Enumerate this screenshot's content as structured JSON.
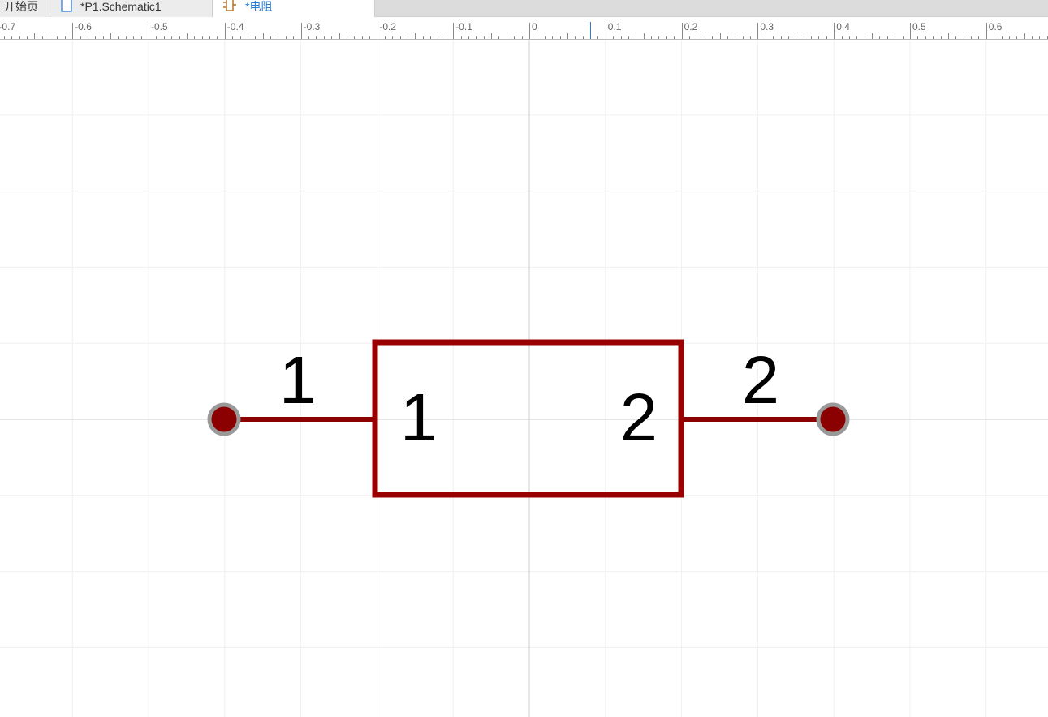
{
  "tabs": [
    {
      "label": "开始页",
      "icon": "none",
      "active": false
    },
    {
      "label": "*P1.Schematic1",
      "icon": "schematic-file-icon",
      "active": false
    },
    {
      "label": "*电阻",
      "icon": "symbol-icon",
      "active": true
    }
  ],
  "ruler": {
    "labels": [
      "-0.7",
      "-0.6",
      "-0.5",
      "-0.4",
      "-0.3",
      "-0.2",
      "-0.1",
      "0",
      "0.1",
      "0.2",
      "0.3",
      "0.4",
      "0.5",
      "0.6"
    ],
    "cursor_value": 0.08
  },
  "symbol": {
    "body_color": "#990000",
    "pin_color": "#8b0000",
    "pin_end_color": "#999999",
    "pins": [
      {
        "number_outside": "1",
        "number_inside": "1"
      },
      {
        "number_outside": "2",
        "number_inside": "2"
      }
    ]
  },
  "colors": {
    "grid": "#f0f0f0",
    "axis": "#cccccc",
    "active_tab_text": "#2a7fd4",
    "cursor_marker": "#2a7fd4"
  }
}
